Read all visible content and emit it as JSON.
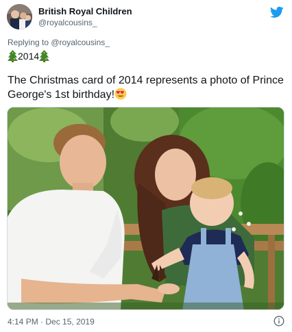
{
  "author": {
    "display_name": "British Royal Children",
    "handle": "@royalcousins_"
  },
  "reply": {
    "prefix": "Replying to ",
    "mention": "@royalcousins_"
  },
  "tag_line": {
    "year": "2014"
  },
  "tweet": {
    "text": "The Christmas card of 2014 represents a photo of Prince George's 1st birthday!"
  },
  "photo": {
    "subject": "family-photo"
  },
  "footer": {
    "time": "4:14 PM",
    "separator": " · ",
    "date": "Dec 15, 2019"
  },
  "colors": {
    "twitter_blue": "#1d9bf0",
    "secondary_text": "#536471",
    "primary_text": "#0f1419"
  },
  "icons": [
    "twitter-bird-icon",
    "christmas-tree-icon",
    "heart-eyes-emoji-icon",
    "info-icon"
  ]
}
